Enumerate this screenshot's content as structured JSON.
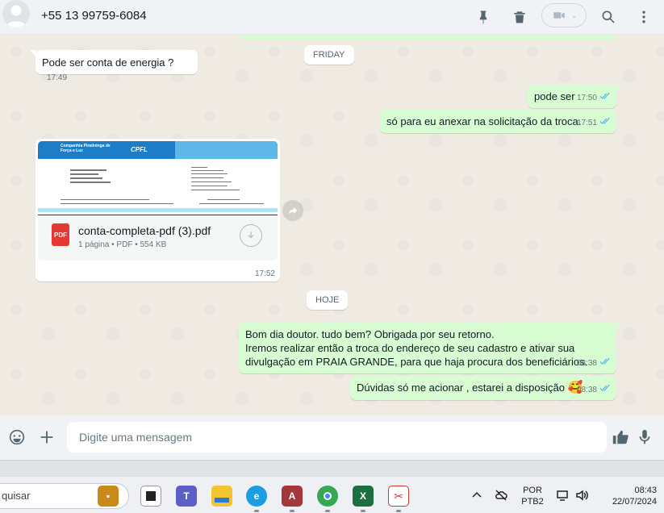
{
  "header": {
    "contact_name": "+55 13 99759-6084",
    "icons": [
      "pin-icon",
      "trash-icon",
      "video-call-icon",
      "search-icon",
      "menu-icon"
    ]
  },
  "chat": {
    "date_labels": {
      "friday": "FRIDAY",
      "today": "HOJE"
    },
    "messages": [
      {
        "direction": "in",
        "text": "Pode ser conta de energia ?",
        "time": "17:49"
      },
      {
        "direction": "out",
        "text": "pode ser",
        "time": "17:50",
        "status": "read"
      },
      {
        "direction": "out",
        "text": "só para eu anexar na solicitação da troca.",
        "time": "17:51",
        "status": "read"
      },
      {
        "direction": "out",
        "lines": [
          "Bom dia doutor. tudo bem? Obrigada por seu retorno.",
          "Iremos realizar então a troca do endereço de seu cadastro e ativar sua",
          "divulgação em PRAIA GRANDE, para que haja procura dos beneficiários."
        ],
        "time": "08:38",
        "status": "read"
      },
      {
        "direction": "out",
        "text": "Dúvidas só me acionar , estarei a disposição",
        "emoji": "🥰",
        "time": "08:38",
        "status": "read"
      }
    ],
    "document": {
      "file_name": "conta-completa-pdf (3).pdf",
      "info": "1 página • PDF • 554 KB",
      "file_badge": "PDF",
      "time": "17:52",
      "preview": {
        "company": "Companhia Piratininga de Força e Luz",
        "logo": "CPFL"
      }
    }
  },
  "composer": {
    "placeholder": "Digite uma mensagem"
  },
  "taskbar": {
    "search_text": "quisar",
    "apps": [
      "briefcase",
      "task-view",
      "teams",
      "file-explorer",
      "edge",
      "access",
      "chrome",
      "excel",
      "snipping-tool"
    ],
    "language": "POR",
    "layout": "PTB2",
    "time": "08:43",
    "date": "22/07/2024"
  },
  "colors": {
    "chat_bg": "#efeae2",
    "outgoing_bubble": "#d9fdd3",
    "incoming_bubble": "#ffffff",
    "read_ticks": "#53bdeb",
    "header_bg": "#f0f2f5"
  }
}
